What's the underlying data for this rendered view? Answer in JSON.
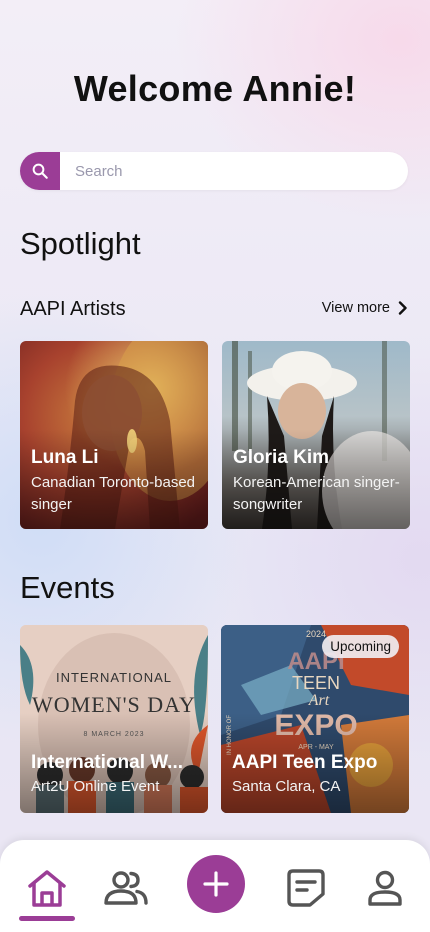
{
  "header": {
    "title": "Welcome Annie!"
  },
  "search": {
    "placeholder": "Search",
    "icon": "search-icon"
  },
  "spotlight": {
    "title": "Spotlight",
    "subtitle": "AAPI Artists",
    "view_more": "View more",
    "artists": [
      {
        "name": "Luna Li",
        "desc": "Canadian Toronto-based singer"
      },
      {
        "name": "Gloria Kim",
        "desc": "Korean-American singer-songwriter"
      }
    ]
  },
  "events": {
    "title": "Events",
    "items": [
      {
        "name": "International W...",
        "desc": "Art2U Online Event",
        "poster_lines": [
          "INTERNATIONAL",
          "WOMEN'S DAY",
          "8 MARCH 2023"
        ]
      },
      {
        "name": "AAPI Teen Expo",
        "desc": "Santa Clara, CA",
        "badge": "Upcoming",
        "poster_lines": [
          "2024",
          "AAPI",
          "TEEN",
          "Art",
          "EXPO",
          "APR - MAY",
          "IN HONOR OF"
        ]
      }
    ]
  },
  "nav": {
    "items": [
      "home-icon",
      "community-icon",
      "add-icon",
      "posts-icon",
      "profile-icon"
    ],
    "active": "home-icon"
  },
  "colors": {
    "accent": "#9b3d96",
    "background": "#ece9f5"
  }
}
